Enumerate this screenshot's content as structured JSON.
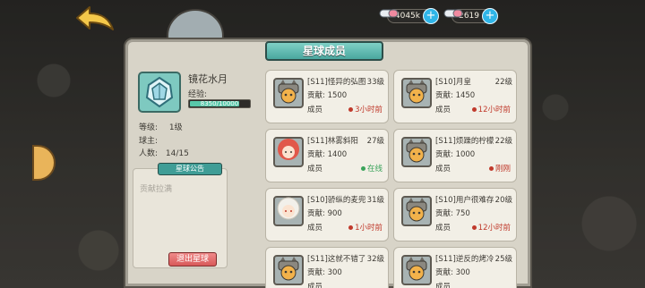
{
  "top_bar": {
    "coins": {
      "value": "4045k",
      "icon": "pill-capsule-icon"
    },
    "gems": {
      "value": "2619",
      "icon": "pill-capsule-icon"
    },
    "plus_label": "+"
  },
  "panel": {
    "title": "星球成员"
  },
  "planet": {
    "name": "镜花水月",
    "xp_label": "经验:",
    "xp_text": "8350/10000",
    "xp_progress": 0.835,
    "level_label": "等级:",
    "level_value": "1级",
    "owner_label": "球主:",
    "owner_value": "",
    "count_label": "人数:",
    "count_value": "14/15",
    "notice_title": "星球公告",
    "notice_text": "贡献拉满",
    "leave_label": "退出星球"
  },
  "members": [
    {
      "name": "[S11]怪异的弘图",
      "level": "33级",
      "contrib": "贡献: 1500",
      "role": "成员",
      "status": "3小时前",
      "status_kind": "offline",
      "avatar": "cat-knight-avatar-icon"
    },
    {
      "name": "[S10]月皇",
      "level": "22级",
      "contrib": "贡献: 1450",
      "role": "成员",
      "status": "12小时前",
      "status_kind": "offline",
      "avatar": "cat-knight-avatar-icon"
    },
    {
      "name": "[S11]林雾斜阳",
      "level": "27级",
      "contrib": "贡献: 1400",
      "role": "成员",
      "status": "在线",
      "status_kind": "online",
      "avatar": "red-hair-girl-avatar-icon"
    },
    {
      "name": "[S11]烦躁的柠檬",
      "level": "22级",
      "contrib": "贡献: 1000",
      "role": "成员",
      "status": "刚刚",
      "status_kind": "offline",
      "avatar": "cat-knight-avatar-icon"
    },
    {
      "name": "[S10]骄纵的麦兜",
      "level": "31级",
      "contrib": "贡献: 900",
      "role": "成员",
      "status": "1小时前",
      "status_kind": "offline",
      "avatar": "white-hair-girl-avatar-icon"
    },
    {
      "name": "[S10]用户很难存在",
      "level": "20级",
      "contrib": "贡献: 750",
      "role": "成员",
      "status": "12小时前",
      "status_kind": "offline",
      "avatar": "cat-knight-avatar-icon"
    },
    {
      "name": "[S11]这就不错了",
      "level": "32级",
      "contrib": "贡献: 300",
      "role": "成员",
      "status": "",
      "status_kind": "offline",
      "avatar": "cat-knight-avatar-icon"
    },
    {
      "name": "[S11]逆反的烤冷面",
      "level": "25级",
      "contrib": "贡献: 300",
      "role": "成员",
      "status": "",
      "status_kind": "offline",
      "avatar": "cat-knight-avatar-icon"
    }
  ],
  "colors": {
    "online": "#3aa35a",
    "offline": "#c0392b"
  }
}
